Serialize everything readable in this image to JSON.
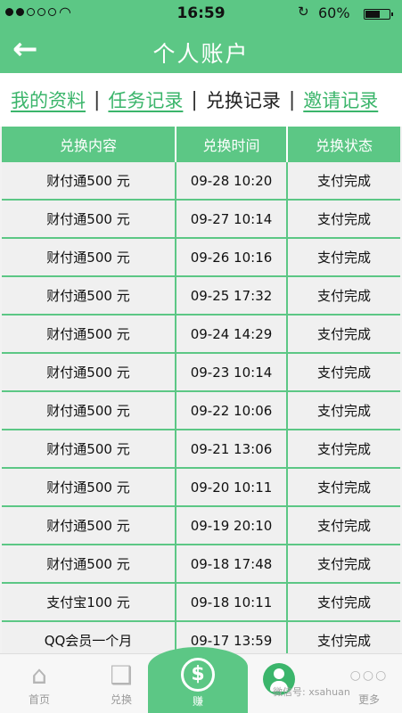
{
  "statusbar": {
    "time": "16:59",
    "battery": "60%",
    "wifi_icon": "wifi-icon",
    "lock_icon": "rotation-lock-icon"
  },
  "navbar": {
    "back_icon": "back-arrow-icon",
    "title": "个人账户"
  },
  "tabs": [
    {
      "label": "我的资料",
      "active": false
    },
    {
      "label": "任务记录",
      "active": false
    },
    {
      "label": "兑换记录",
      "active": true
    },
    {
      "label": "邀请记录",
      "active": false
    }
  ],
  "table": {
    "headers": [
      "兑换内容",
      "兑换时间",
      "兑换状态"
    ],
    "rows": [
      [
        "财付通500 元",
        "09-28 10:20",
        "支付完成"
      ],
      [
        "财付通500 元",
        "09-27 10:14",
        "支付完成"
      ],
      [
        "财付通500 元",
        "09-26 10:16",
        "支付完成"
      ],
      [
        "财付通500 元",
        "09-25 17:32",
        "支付完成"
      ],
      [
        "财付通500 元",
        "09-24 14:29",
        "支付完成"
      ],
      [
        "财付通500 元",
        "09-23 10:14",
        "支付完成"
      ],
      [
        "财付通500 元",
        "09-22 10:06",
        "支付完成"
      ],
      [
        "财付通500 元",
        "09-21 13:06",
        "支付完成"
      ],
      [
        "财付通500 元",
        "09-20 10:11",
        "支付完成"
      ],
      [
        "财付通500 元",
        "09-19 20:10",
        "支付完成"
      ],
      [
        "财付通500 元",
        "09-18 17:48",
        "支付完成"
      ],
      [
        "支付宝100 元",
        "09-18 10:11",
        "支付完成"
      ],
      [
        "QQ会员一个月",
        "09-17 13:59",
        "支付完成"
      ]
    ]
  },
  "tabbar": {
    "home": "首页",
    "exchange": "兑换",
    "earn": "赚",
    "earn_symbol": "$",
    "more": "更多",
    "more_symbol": "○○○",
    "watermark": "微信号: xsahuan"
  },
  "colors": {
    "accent": "#5cc785",
    "link": "#3bb56b"
  }
}
